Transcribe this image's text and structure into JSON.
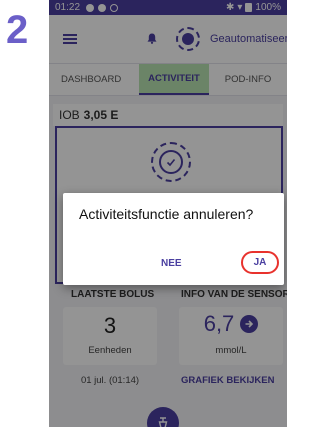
{
  "step": {
    "number": "2"
  },
  "status_bar": {
    "time": "01:22",
    "battery": "100%"
  },
  "app_bar": {
    "mode_label": "Geautomatiseerd"
  },
  "tabs": [
    {
      "label": "DASHBOARD"
    },
    {
      "label": "ACTIVITEIT"
    },
    {
      "label": "POD-INFO"
    }
  ],
  "iob": {
    "label": "IOB",
    "value": "3,05 E"
  },
  "last_bolus": {
    "header": "LAATSTE BOLUS",
    "value": "3",
    "unit": "Eenheden",
    "time": "01 jul. (01:14)"
  },
  "sensor": {
    "header": "INFO VAN DE SENSOR",
    "value": "6,7",
    "unit": "mmol/L",
    "link_label": "GRAFIEK BEKIJKEN"
  },
  "dialog": {
    "title": "Activiteitsfunctie annuleren?",
    "cancel_label": "NEE",
    "confirm_label": "JA"
  },
  "colors": {
    "primary": "#4a3fa0",
    "active_tab": "#b9e3b2",
    "highlight": "#e8322d"
  },
  "icons": [
    "menu-icon",
    "bell-icon",
    "mode-icon",
    "activity-icon",
    "arrow-right-icon",
    "bolus-icon"
  ]
}
